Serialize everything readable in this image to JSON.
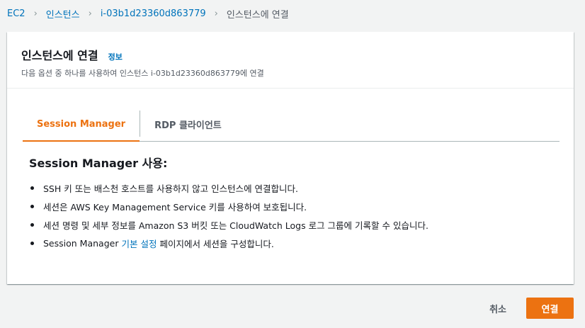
{
  "breadcrumb": {
    "items": [
      "EC2",
      "인스턴스",
      "i-03b1d23360d863779",
      "인스턴스에 연결"
    ],
    "separator": "›"
  },
  "panel": {
    "title": "인스턴스에 연결",
    "info_link": "정보",
    "description": "다음 옵션 중 하나를 사용하여 인스턴스 i-03b1d23360d863779에 연결"
  },
  "tabs": [
    {
      "label": "Session Manager",
      "active": true
    },
    {
      "label": "RDP 클라이언트",
      "active": false
    }
  ],
  "session_manager": {
    "heading": "Session Manager 사용:",
    "bullets": [
      "SSH 키 또는 배스천 호스트를 사용하지 않고 인스턴스에 연결합니다.",
      "세션은 AWS Key Management Service 키를 사용하여 보호됩니다.",
      "세션 명령 및 세부 정보를 Amazon S3 버킷 또는 CloudWatch Logs 로그 그룹에 기록할 수 있습니다."
    ],
    "last_bullet": {
      "prefix": "Session Manager",
      "link": "기본 설정",
      "suffix": "페이지에서 세션을 구성합니다."
    }
  },
  "actions": {
    "cancel_label": "취소",
    "connect_label": "연결"
  },
  "colors": {
    "accent": "#ec7211",
    "link": "#0073bb",
    "background": "#f2f3f3"
  }
}
